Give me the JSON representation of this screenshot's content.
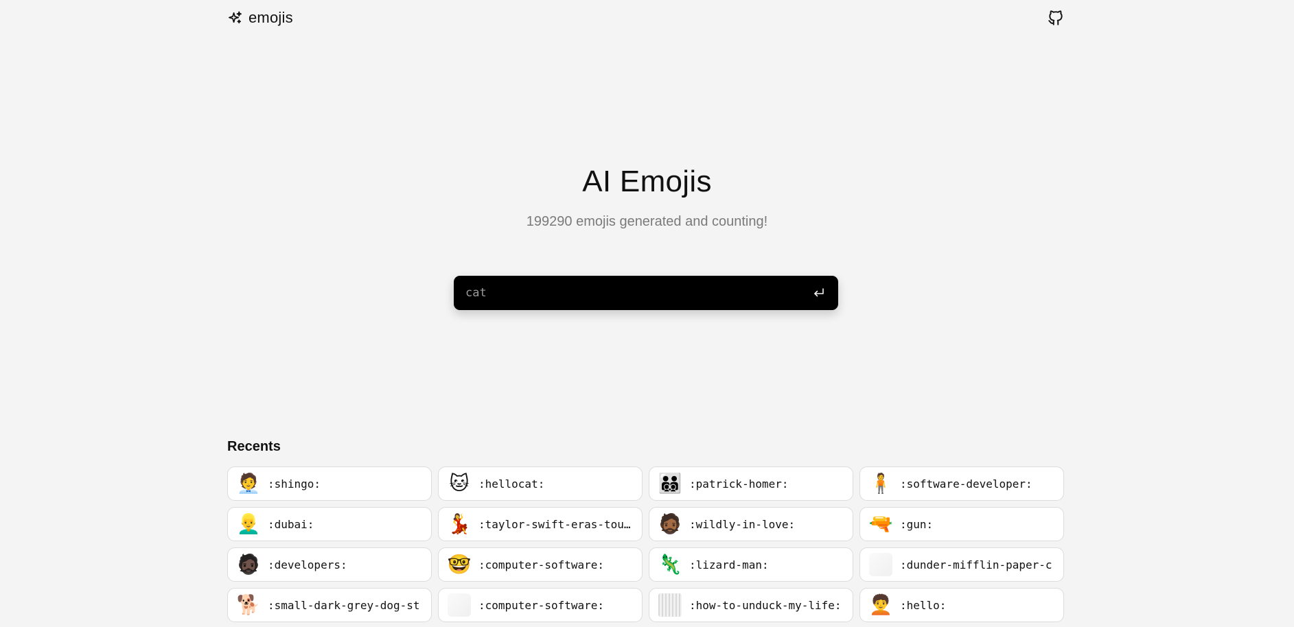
{
  "header": {
    "brand_label": "emojis",
    "brand_icon": "sparkles-icon",
    "github_icon": "github-icon"
  },
  "hero": {
    "title": "AI Emojis",
    "subtitle": "199290 emojis generated and counting!"
  },
  "search": {
    "placeholder": "cat",
    "value": "",
    "submit_icon": "enter-icon"
  },
  "recents": {
    "heading": "Recents",
    "items": [
      {
        "label": ":shingo:",
        "thumb": "🧑‍💼"
      },
      {
        "label": ":hellocat:",
        "thumb": "🐱"
      },
      {
        "label": ":patrick-homer:",
        "thumb": "👨‍👨‍👦‍👦"
      },
      {
        "label": ":software-developer:",
        "thumb": "🧍"
      },
      {
        "label": ":dubai:",
        "thumb": "👱‍♂️"
      },
      {
        "label": ":taylor-swift-eras-tour:",
        "thumb": "💃"
      },
      {
        "label": ":wildly-in-love:",
        "thumb": "🧔🏾"
      },
      {
        "label": ":gun:",
        "thumb": "🔫"
      },
      {
        "label": ":developers:",
        "thumb": "🧔🏿"
      },
      {
        "label": ":computer-software:",
        "thumb": "🤓"
      },
      {
        "label": ":lizard-man:",
        "thumb": "🦎"
      },
      {
        "label": ":dunder-mifflin-paper-c",
        "thumb": ""
      },
      {
        "label": ":small-dark-grey-dog-st",
        "thumb": "🐕"
      },
      {
        "label": ":computer-software:",
        "thumb": ""
      },
      {
        "label": ":how-to-unduck-my-life:",
        "thumb": ""
      },
      {
        "label": ":hello:",
        "thumb": "🧑‍🦱"
      }
    ]
  }
}
